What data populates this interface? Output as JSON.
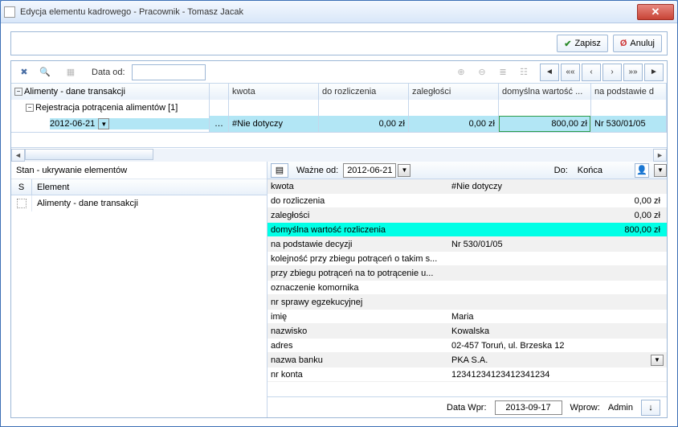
{
  "window": {
    "title": "Edycja elementu kadrowego - Pracownik - Tomasz Jacak"
  },
  "actions": {
    "save": "Zapisz",
    "cancel": "Anuluj"
  },
  "toolbar": {
    "date_from_label": "Data od:",
    "date_from_value": ""
  },
  "tree": {
    "root": "Alimenty - dane transakcji",
    "child": "Rejestracja potrącenia alimentów [1]",
    "leaf_date": "2012-06-21"
  },
  "grid": {
    "headers": [
      "kwota",
      "do rozliczenia",
      "zaległości",
      "domyślna wartość ...",
      "na podstawie d"
    ],
    "row": {
      "kwota": "#Nie dotyczy",
      "do_rozliczenia": "0,00 zł",
      "zaleglosci": "0,00 zł",
      "domyslna": "800,00 zł",
      "na_podstawie": "Nr 530/01/05"
    }
  },
  "state_pane": {
    "title": "Stan - ukrywanie elementów",
    "col_s": "S",
    "col_el": "Element",
    "item": "Alimenty - dane transakcji"
  },
  "detail_header": {
    "wazne_od_label": "Ważne od:",
    "wazne_od_value": "2012-06-21",
    "do_label": "Do:",
    "do_value": "Końca"
  },
  "details": [
    {
      "k": "kwota",
      "v": "#Nie dotyczy",
      "money": false
    },
    {
      "k": "do rozliczenia",
      "v": "0,00 zł",
      "money": true
    },
    {
      "k": "zaległości",
      "v": "0,00 zł",
      "money": true
    },
    {
      "k": "domyślna wartość rozliczenia",
      "v": "800,00 zł",
      "money": true,
      "sel": true
    },
    {
      "k": "na podstawie decyzji",
      "v": "Nr 530/01/05",
      "money": false
    },
    {
      "k": "kolejność przy zbiegu potrąceń o takim s...",
      "v": "",
      "money": false
    },
    {
      "k": "przy zbiegu potrąceń na to potrącenie u...",
      "v": "",
      "money": false
    },
    {
      "k": "oznaczenie komornika",
      "v": "",
      "money": false
    },
    {
      "k": "nr sprawy egzekucyjnej",
      "v": "",
      "money": false
    },
    {
      "k": "imię",
      "v": "Maria",
      "money": false
    },
    {
      "k": "nazwisko",
      "v": "Kowalska",
      "money": false
    },
    {
      "k": "adres",
      "v": "02-457 Toruń, ul. Brzeska 12",
      "money": false
    },
    {
      "k": "nazwa banku",
      "v": "PKA S.A.",
      "money": false,
      "drop": true
    },
    {
      "k": "nr konta",
      "v": "12341234123412341234",
      "money": false
    }
  ],
  "footer": {
    "data_wpr_label": "Data Wpr:",
    "data_wpr_value": "2013-09-17",
    "wprow_label": "Wprow:",
    "wprow_value": "Admin"
  }
}
